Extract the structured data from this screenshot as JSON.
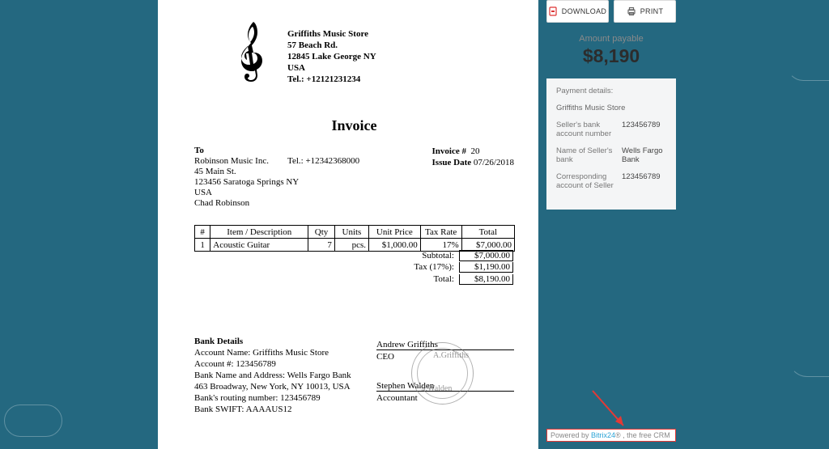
{
  "company": {
    "name": "Griffiths Music Store",
    "addr1": "57 Beach Rd.",
    "addr2": "12845 Lake George NY",
    "country": "USA",
    "tel": "Tel.: +12121231234"
  },
  "title": "Invoice",
  "to": {
    "label": "To",
    "name": "Robinson Music Inc.",
    "addr1": "45 Main St.",
    "addr2": "123456 Saratoga Springs NY",
    "country": "USA",
    "contact": "Chad Robinson",
    "tel": "Tel.: +12342368000"
  },
  "meta": {
    "invoice_no_label": "Invoice #",
    "invoice_no": "20",
    "issue_date_label": "Issue Date",
    "issue_date": "07/26/2018"
  },
  "table": {
    "headers": [
      "#",
      "Item / Description",
      "Qty",
      "Units",
      "Unit Price",
      "Tax Rate",
      "Total"
    ],
    "row": {
      "n": "1",
      "desc": "Acoustic Guitar",
      "qty": "7",
      "units": "pcs.",
      "price": "$1,000.00",
      "tax": "17%",
      "total": "$7,000.00"
    }
  },
  "totals": {
    "subtotal_label": "Subtotal:",
    "subtotal": "$7,000.00",
    "tax_label": "Tax (17%):",
    "tax": "$1,190.00",
    "total_label": "Total:",
    "total": "$8,190.00"
  },
  "bank": {
    "hdr": "Bank Details",
    "l1": "Account Name: Griffiths Music Store",
    "l2": "Account #: 123456789",
    "l3": "Bank Name and Address: Wells Fargo Bank",
    "l4": "463 Broadway, New York, NY 10013, USA",
    "l5": "Bank's routing number: 123456789",
    "l6": "Bank SWIFT: AAAAUS12"
  },
  "sign": {
    "p1": "Andrew Griffiths",
    "r1": "CEO",
    "p2": "Stephen Walden",
    "r2": "Accountant"
  },
  "panel": {
    "download": "DOWNLOAD",
    "print": "PRINT",
    "amount_label": "Amount payable",
    "amount": "$8,190",
    "payment_details": "Payment details:",
    "store": "Griffiths Music Store",
    "k1": "Seller's bank account number",
    "v1": "123456789",
    "k2": "Name of Seller's bank",
    "v2": "Wells Fargo Bank",
    "k3": "Corresponding account of Seller",
    "v3": "123456789"
  },
  "powered": {
    "pre": "Powered by ",
    "brand": "Bitrix24",
    "suf": "® , the free CRM"
  }
}
